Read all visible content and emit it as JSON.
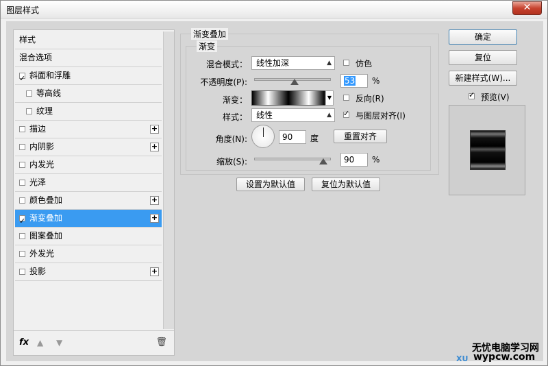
{
  "window": {
    "title": "图层样式",
    "close_label": "✕"
  },
  "styles_list": {
    "items": [
      {
        "label": "样式",
        "checkbox": false,
        "checked": false,
        "plus": false,
        "indent": false,
        "selected": false
      },
      {
        "label": "混合选项",
        "checkbox": false,
        "checked": false,
        "plus": false,
        "indent": false,
        "selected": false
      },
      {
        "label": "斜面和浮雕",
        "checkbox": true,
        "checked": true,
        "plus": false,
        "indent": false,
        "selected": false
      },
      {
        "label": "等高线",
        "checkbox": true,
        "checked": false,
        "plus": false,
        "indent": true,
        "selected": false
      },
      {
        "label": "纹理",
        "checkbox": true,
        "checked": false,
        "plus": false,
        "indent": true,
        "selected": false
      },
      {
        "label": "描边",
        "checkbox": true,
        "checked": false,
        "plus": true,
        "indent": false,
        "selected": false
      },
      {
        "label": "内阴影",
        "checkbox": true,
        "checked": false,
        "plus": true,
        "indent": false,
        "selected": false
      },
      {
        "label": "内发光",
        "checkbox": true,
        "checked": false,
        "plus": false,
        "indent": false,
        "selected": false
      },
      {
        "label": "光泽",
        "checkbox": true,
        "checked": false,
        "plus": false,
        "indent": false,
        "selected": false
      },
      {
        "label": "颜色叠加",
        "checkbox": true,
        "checked": false,
        "plus": true,
        "indent": false,
        "selected": false
      },
      {
        "label": "渐变叠加",
        "checkbox": true,
        "checked": true,
        "plus": true,
        "indent": false,
        "selected": true
      },
      {
        "label": "图案叠加",
        "checkbox": true,
        "checked": false,
        "plus": false,
        "indent": false,
        "selected": false
      },
      {
        "label": "外发光",
        "checkbox": true,
        "checked": false,
        "plus": false,
        "indent": false,
        "selected": false
      },
      {
        "label": "投影",
        "checkbox": true,
        "checked": false,
        "plus": true,
        "indent": false,
        "selected": false
      }
    ],
    "fx_label": "fx",
    "up_icon": "▲",
    "down_icon": "▼",
    "trash_icon": "🗑"
  },
  "gradient_overlay": {
    "group_title": "渐变叠加",
    "sub_title": "渐变",
    "blend_mode_label": "混合模式：",
    "blend_mode_value": "线性加深",
    "dither_label": "仿色",
    "opacity_label": "不透明度(P):",
    "opacity_value": "53",
    "opacity_percent": 53,
    "percent_sign": "%",
    "gradient_label": "渐变：",
    "reverse_label": "反向(R)",
    "style_label": "样式：",
    "style_value": "线性",
    "align_label": "与图层对齐(I)",
    "angle_label": "角度(N):",
    "angle_value": "90",
    "degree_sign": "度",
    "reset_align_label": "重置对齐",
    "scale_label": "缩放(S):",
    "scale_value": "90",
    "scale_percent": 90,
    "set_default_label": "设置为默认值",
    "reset_default_label": "复位为默认值"
  },
  "right_buttons": {
    "ok_label": "确定",
    "reset_label": "复位",
    "new_style_label": "新建样式(W)...",
    "preview_label": "预览(V)"
  },
  "watermark": {
    "line1": "无忧电脑学习网",
    "line2": "wypcw.com",
    "prefix": "XU"
  }
}
